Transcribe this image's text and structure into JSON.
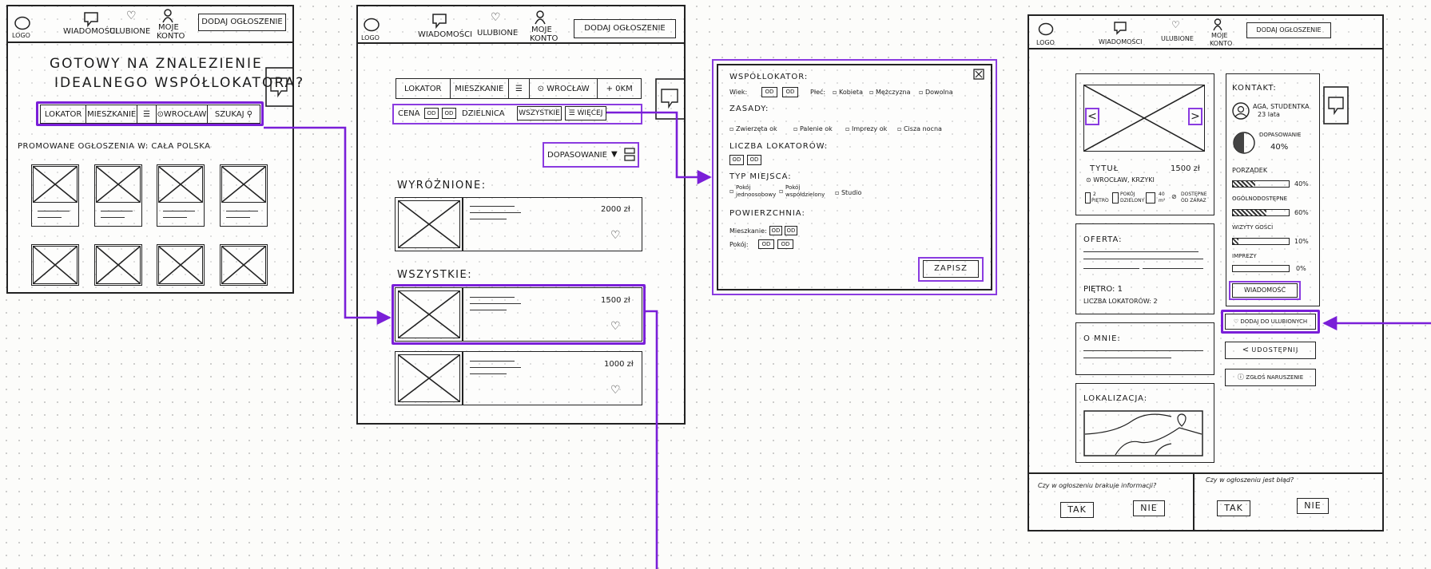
{
  "header": {
    "logo": "LOGO",
    "messages": "WIADOMOŚCI",
    "favorites": "ULUBIONE",
    "account_line1": "MOJE",
    "account_line2": "KONTO",
    "add_listing": "DODAJ OGŁOSZENIE"
  },
  "home": {
    "hero_line1": "GOTOWY NA ZNALEZIENIE",
    "hero_line2": "IDEALNEGO WSPÓŁLOKATORA?",
    "search": {
      "tab_tenant": "LOKATOR",
      "tab_flat": "MIESZKANIE",
      "location": "WROCŁAW",
      "search_btn": "SZUKAJ"
    },
    "promoted": "PROMOWANE OGŁOSZENIA W: CAŁA POLSKA"
  },
  "results": {
    "filter": {
      "tab_tenant": "LOKATOR",
      "tab_flat": "MIESZKANIE",
      "location": "WROCŁAW",
      "radius": "+ 0KM",
      "price": "CENA",
      "range_box": "OD",
      "district": "DZIELNICA",
      "all": "WSZYSTKIE",
      "more": "WIĘCEJ"
    },
    "sort": "DOPASOWANIE",
    "featured": "WYRÓŻNIONE:",
    "all_heading": "WSZYSTKIE:",
    "listings": [
      {
        "price": "2000 zł"
      },
      {
        "price": "1500 zł"
      },
      {
        "price": "1000 zł"
      }
    ]
  },
  "filters_modal": {
    "title": "WSPÓŁLOKATOR:",
    "age": "Wiek:",
    "sex": "Płeć:",
    "opt_female": "Kobieta",
    "opt_male": "Mężczyzna",
    "opt_any": "Dowolna",
    "rules": "ZASADY:",
    "rule1": "Zwierzęta ok",
    "rule2": "Palenie ok",
    "rule3": "Imprezy ok",
    "rule4": "Cisza nocna",
    "tenants": "LICZBA LOKATORÓW:",
    "place_type": "TYP MIEJSCA:",
    "place1a": "Pokój",
    "place1b": "jednoosobowy",
    "place2a": "Pokój",
    "place2b": "współdzielony",
    "place3": "Studio",
    "area": "POWIERZCHNIA:",
    "area_flat": "Mieszkanie:",
    "area_room": "Pokój:",
    "range_box": "OD",
    "save": "ZAPISZ"
  },
  "detail": {
    "title": "TYTUŁ",
    "price": "1500 zł",
    "loc": "WROCŁAW, KRZYKI",
    "feat1a": "2",
    "feat1b": "PIĘTRO",
    "feat2a": "POKÓJ",
    "feat2b": "DZIELONY",
    "feat3a": "40",
    "feat3b": "m²",
    "feat4a": "DOSTĘPNE",
    "feat4b": "OD ZARAZ",
    "offer": "OFERTA:",
    "floor": "PIĘTRO: 1",
    "tenants": "LICZBA LOKATORÓW: 2",
    "about": "O MNIE:",
    "location": "LOKALIZACJA:",
    "contact": "KONTAKT:",
    "person_name": "AGA, STUDENTKA",
    "person_age": "23 lata",
    "match_label": "DOPASOWANIE",
    "match_value": "40%",
    "order_label": "PORZĄDEK",
    "order_value": "40%",
    "quiet_label": "OGÓLNODOSTĘPNE",
    "quiet_value": "60%",
    "guests_label": "WIZYTY GOŚCI",
    "guests_value": "10%",
    "party_label": "IMPREZY",
    "party_value": "0%",
    "message_btn": "WIADOMOŚĆ",
    "fav_btn": "DODAJ DO ULUBIONYCH",
    "share_btn": "UDOSTĘPNIJ",
    "report_btn": "ZGŁOŚ NARUSZENIE",
    "q1": "Czy w ogłoszeniu brakuje informacji?",
    "q2": "Czy w ogłoszeniu jest błąd?",
    "yes": "TAK",
    "no": "NIE"
  },
  "colors": {
    "accent": "#7a1fd8",
    "ink": "#1a1a1a"
  }
}
